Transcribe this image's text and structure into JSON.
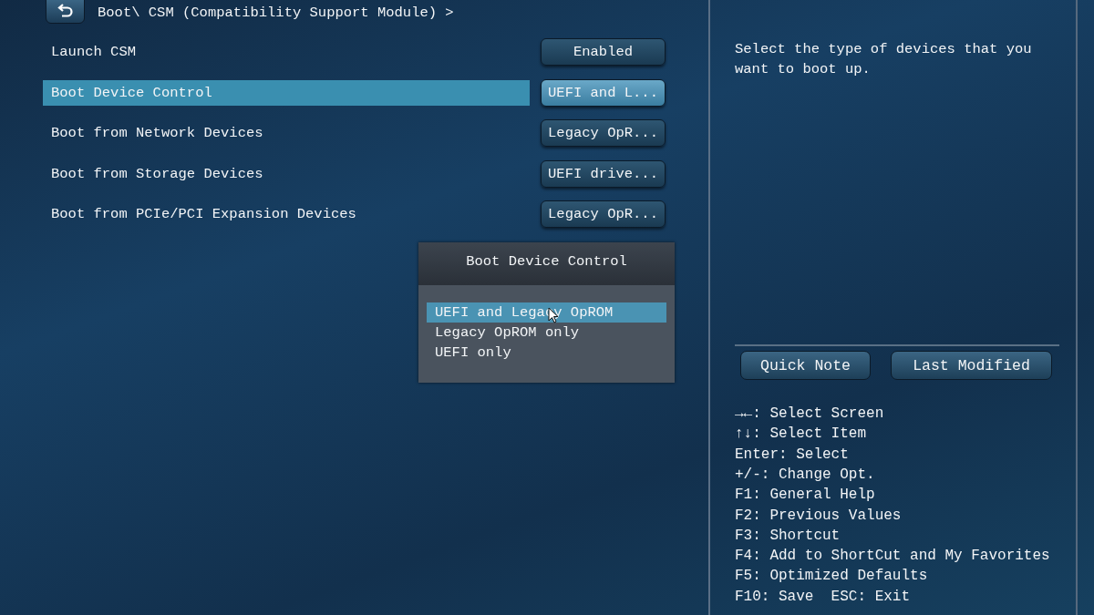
{
  "header": {
    "breadcrumb": "Boot\\ CSM (Compatibility Support Module) >"
  },
  "settings": [
    {
      "label": "Launch CSM",
      "value": "Enabled",
      "selected": false
    },
    {
      "label": "Boot Device Control",
      "value": "UEFI and L...",
      "selected": true
    },
    {
      "label": "Boot from Network Devices",
      "value": "Legacy OpR...",
      "selected": false
    },
    {
      "label": "Boot from Storage Devices",
      "value": "UEFI drive...",
      "selected": false
    },
    {
      "label": "Boot from PCIe/PCI Expansion Devices",
      "value": "Legacy OpR...",
      "selected": false
    }
  ],
  "dropdown": {
    "title": "Boot Device Control",
    "options": [
      {
        "label": "UEFI and Legacy OpROM",
        "selected": true
      },
      {
        "label": "Legacy OpROM only",
        "selected": false
      },
      {
        "label": "UEFI only",
        "selected": false
      }
    ]
  },
  "help_text": "Select the type of devices that you want to boot up.",
  "buttons": [
    "Quick Note",
    "Last Modified"
  ],
  "key_help": [
    "→←: Select Screen",
    "↑↓: Select Item",
    "Enter: Select",
    "+/-: Change Opt.",
    "F1: General Help",
    "F2: Previous Values",
    "F3: Shortcut",
    "F4: Add to ShortCut and My Favorites",
    "F5: Optimized Defaults",
    "F10: Save  ESC: Exit"
  ]
}
